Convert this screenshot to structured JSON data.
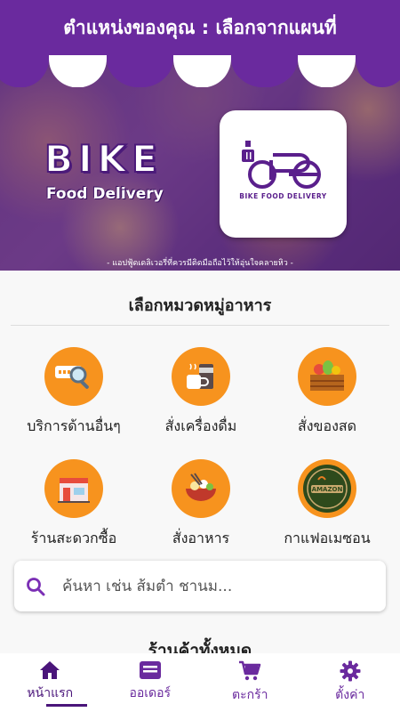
{
  "header": {
    "title": "ตำแหน่งของคุณ : เลือกจากแผนที่"
  },
  "banner": {
    "brand": "BIKE",
    "brand_sub": "Food Delivery",
    "logo_text": "BIKE FOOD DELIVERY",
    "tagline": "- แอปฟู้ดเดลิเวอรี่ที่ควรมีติดมือถือไว้ให้อุ่นใจคลายหิว -"
  },
  "categories": {
    "title": "เลือกหมวดหมู่อาหาร",
    "items": [
      {
        "label": "บริการด้านอื่นๆ",
        "icon": "search-service-icon"
      },
      {
        "label": "สั่งเครื่องดื่ม",
        "icon": "drink-icon"
      },
      {
        "label": "สั่งของสด",
        "icon": "fresh-crate-icon"
      },
      {
        "label": "ร้านสะดวกซื้อ",
        "icon": "convenience-store-icon"
      },
      {
        "label": "สั่งอาหาร",
        "icon": "food-bowl-icon"
      },
      {
        "label": "กาแฟอเมซอน",
        "icon": "amazon-coffee-logo-icon"
      }
    ]
  },
  "search": {
    "placeholder": "ค้นหา เช่น ส้มตำ ชานม..."
  },
  "stores": {
    "title": "ร้านค้าทั้งหมด"
  },
  "nav": {
    "items": [
      {
        "label": "หน้าแรก",
        "icon": "home-icon"
      },
      {
        "label": "ออเดอร์",
        "icon": "order-icon"
      },
      {
        "label": "ตะกร้า",
        "icon": "cart-icon"
      },
      {
        "label": "ตั้งค่า",
        "icon": "gear-icon"
      }
    ]
  },
  "colors": {
    "primary": "#6a2a9e",
    "accent": "#f7931e",
    "nav_active": "#4a157a"
  }
}
